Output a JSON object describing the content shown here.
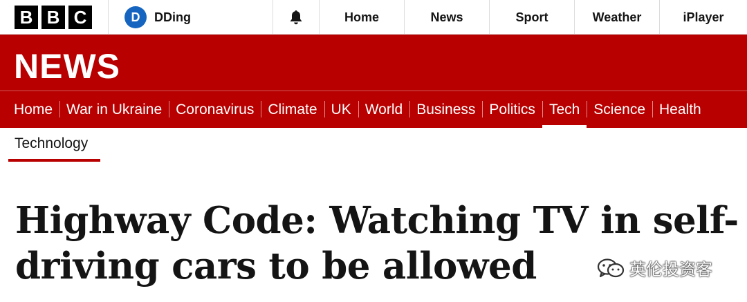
{
  "topbar": {
    "logo_letters": [
      "B",
      "B",
      "C"
    ],
    "account": {
      "initial": "D",
      "name": "DDing"
    },
    "notifications_icon": "bell-icon",
    "nav": [
      "Home",
      "News",
      "Sport",
      "Weather",
      "iPlayer"
    ]
  },
  "masthead": {
    "title": "NEWS",
    "background_color": "#b80000",
    "sections": [
      "Home",
      "War in Ukraine",
      "Coronavirus",
      "Climate",
      "UK",
      "World",
      "Business",
      "Politics",
      "Tech",
      "Science",
      "Health"
    ],
    "active_section": "Tech"
  },
  "subsection": {
    "label": "Technology"
  },
  "article": {
    "headline": "Highway Code: Watching TV in self-driving cars to be allowed"
  },
  "watermark": {
    "text": "英伦投资客",
    "icon": "wechat-icon"
  }
}
